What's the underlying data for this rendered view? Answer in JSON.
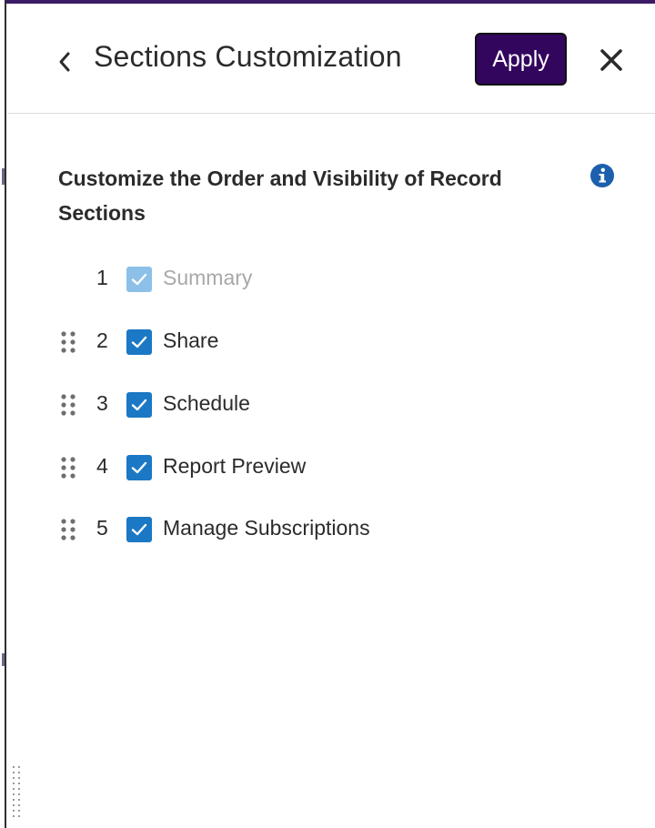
{
  "header": {
    "title": "Sections Customization",
    "apply_label": "Apply"
  },
  "colors": {
    "accent": "#33065e",
    "checkbox": "#1b78c4",
    "checkbox_disabled": "#8cc0e8",
    "info_icon": "#1c5fae"
  },
  "icons": {
    "back": "chevron-left-icon",
    "close": "close-icon",
    "info": "info-icon",
    "drag": "drag-handle-icon",
    "check": "check-icon"
  },
  "main": {
    "heading": "Customize the Order and Visibility of Record Sections",
    "sections": [
      {
        "index": "1",
        "label": "Summary",
        "checked": true,
        "disabled": true,
        "draggable": false
      },
      {
        "index": "2",
        "label": "Share",
        "checked": true,
        "disabled": false,
        "draggable": true
      },
      {
        "index": "3",
        "label": "Schedule",
        "checked": true,
        "disabled": false,
        "draggable": true
      },
      {
        "index": "4",
        "label": "Report Preview",
        "checked": true,
        "disabled": false,
        "draggable": true
      },
      {
        "index": "5",
        "label": "Manage Subscriptions",
        "checked": true,
        "disabled": false,
        "draggable": true
      }
    ]
  }
}
